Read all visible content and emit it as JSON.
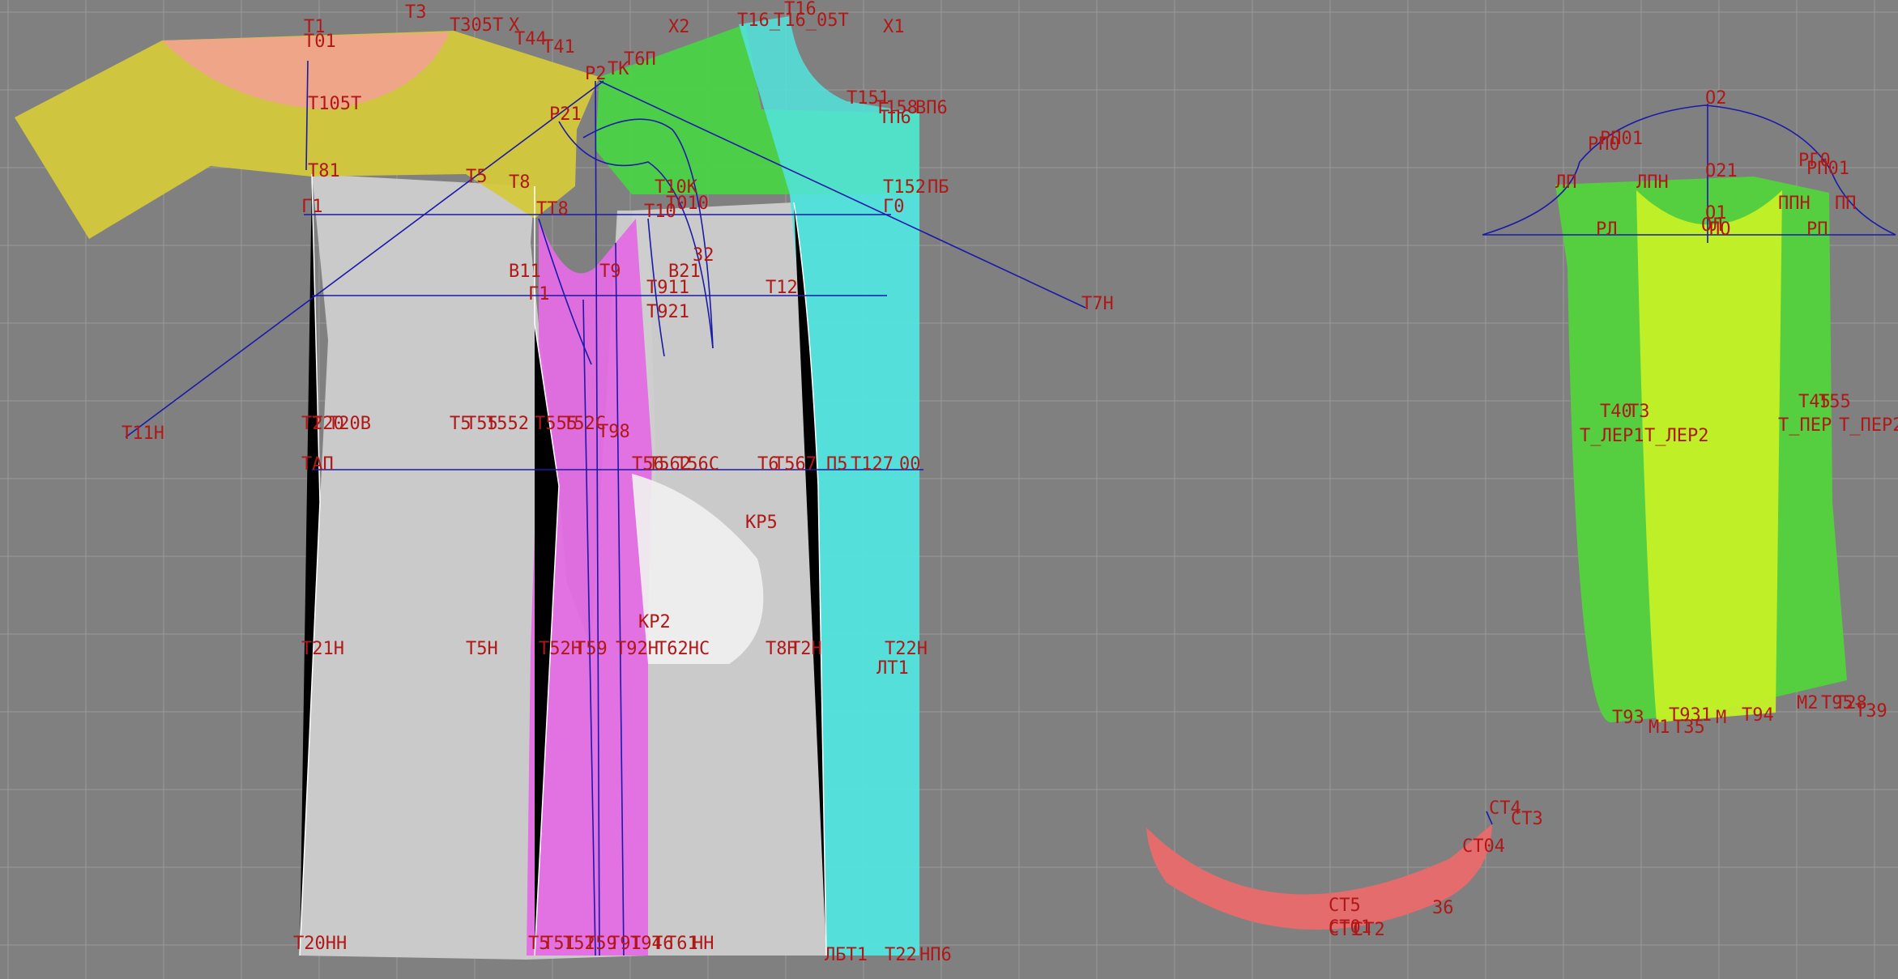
{
  "colors": {
    "background": "#808080",
    "grid": "#9a9a9a",
    "label": "#b01818",
    "construction_line": "#1a1aa8",
    "yoke": "#d4c83a",
    "neck_inset": "#f0a48c",
    "front_panel": "#cdcdcd",
    "side_panel": "#e36be3",
    "shoulder_green": "#4ad246",
    "side_cyan": "#52e4de",
    "sleeve_outer": "#52d23c",
    "sleeve_inner": "#c4f026",
    "collar_band": "#e96a6a",
    "pocket": "#eeeeee"
  },
  "labels": {
    "yoke": [
      "T1",
      "T3",
      "T305T",
      "X",
      "T44",
      "T41",
      "X2",
      "T16",
      "T16_",
      "T16_05T",
      "X1",
      "T01",
      "P2",
      "TK",
      "T6П",
      "T105T",
      "P21",
      "T81",
      "T5",
      "T8",
      "Г1",
      "TT8",
      "T10K",
      "T010",
      "T10",
      "T151",
      "T158",
      "TП6",
      "ВП6",
      "T152",
      "ПБ",
      "Г0"
    ],
    "body": [
      "B11",
      "T9",
      "T911",
      "B21",
      "32",
      "T12",
      "Г1",
      "T921",
      "T7H",
      "T11H",
      "T2",
      "T20",
      "T20B",
      "T5",
      "T55",
      "T552",
      "T555",
      "T52C",
      "T98",
      "TAП",
      "T56",
      "T562",
      "T56C",
      "T6",
      "T567",
      "П5",
      "T127",
      "00",
      "KP5",
      "KP2",
      "T22H",
      "T21H",
      "T5H",
      "T52H",
      "T59",
      "T92H",
      "T62HC",
      "T8H",
      "T2H",
      "ЛT1",
      "T20HH",
      "T5",
      "T51",
      "T52",
      "T59",
      "T91",
      "T94",
      "T6",
      "T61",
      "HH",
      "ЛБT1",
      "T22",
      "HП6"
    ],
    "sleeve": [
      "O2",
      "PП0",
      "PП01",
      "O21",
      "PГ0",
      "PП01",
      "ЛП",
      "ЛПН",
      "ППН",
      "ПП",
      "PЛ",
      "ОЛ",
      "PП",
      "O1",
      "ПО",
      "T40",
      "T3",
      "T_ЛЕР1",
      "T_ЛЕР2",
      "T45",
      "T55",
      "T_ПЕР",
      "T_ПЕР2",
      "T93",
      "T931",
      "M1",
      "T35",
      "M",
      "T94",
      "M2",
      "T95",
      "T28",
      "T39"
    ],
    "collar": [
      "CT4",
      "CT3",
      "CT04",
      "CT5",
      "CT1",
      "CT01",
      "CT2",
      "36"
    ]
  }
}
